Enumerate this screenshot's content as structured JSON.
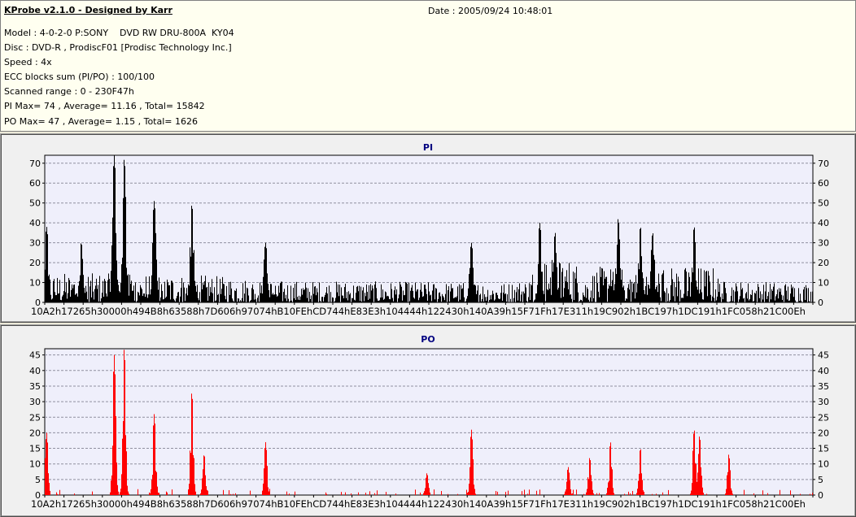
{
  "header": {
    "title": "KProbe v2.1.0 - Designed by Karr",
    "date": "Date : 2005/09/24 10:48:01",
    "lines": [
      "Model : 4-0-2-0 P:SONY    DVD RW DRU-800A  KY04",
      "Disc : DVD-R , ProdiscF01 [Prodisc Technology Inc.]",
      "Speed : 4x",
      "ECC blocks sum (PI/PO) : 100/100",
      "Scanned range : 0 - 230F47h",
      "PI Max= 74 , Average= 11.16 , Total= 15842",
      "PO Max= 47 , Average= 1.15 , Total= 1626"
    ]
  },
  "chart_data": [
    {
      "type": "bar",
      "title": "PI",
      "xlabel": "",
      "ylabel": "",
      "ylim": [
        0,
        74
      ],
      "yticks": [
        0,
        10,
        20,
        30,
        40,
        50,
        60,
        70
      ],
      "xtick_labels": [
        "10A2h",
        "17265h",
        "30000h",
        "494B8h",
        "63588h",
        "7D606h",
        "97074h",
        "B10FEh",
        "CD744h",
        "E83E3h",
        "104444h",
        "122430h",
        "140A39h",
        "15F71Fh",
        "17E311h",
        "19C902h",
        "1BC197h",
        "1DC191h",
        "1FC058h",
        "21C00Eh"
      ],
      "x_units": "percent of scanned range",
      "baseline": [
        [
          0,
          15
        ],
        [
          20,
          14
        ],
        [
          30,
          11
        ],
        [
          60,
          10
        ],
        [
          63,
          12
        ],
        [
          64,
          22
        ],
        [
          69,
          22
        ],
        [
          70,
          12
        ],
        [
          72,
          18
        ],
        [
          87,
          18
        ],
        [
          88,
          11
        ],
        [
          100,
          10
        ]
      ],
      "peaks": [
        [
          0.2,
          38
        ],
        [
          4.7,
          30
        ],
        [
          9.0,
          74
        ],
        [
          10.3,
          72
        ],
        [
          14.2,
          51
        ],
        [
          19.1,
          49
        ],
        [
          28.7,
          30
        ],
        [
          55.5,
          30
        ],
        [
          64.4,
          40
        ],
        [
          66.4,
          35
        ],
        [
          74.6,
          42
        ],
        [
          77.5,
          38
        ],
        [
          79.1,
          35
        ],
        [
          84.5,
          38
        ]
      ],
      "color": "#000000"
    },
    {
      "type": "bar",
      "title": "PO",
      "xlabel": "",
      "ylabel": "",
      "ylim": [
        0,
        47
      ],
      "yticks": [
        0,
        5,
        10,
        15,
        20,
        25,
        30,
        35,
        40,
        45
      ],
      "xtick_labels": [
        "10A2h",
        "17265h",
        "30000h",
        "494B8h",
        "63588h",
        "7D606h",
        "97074h",
        "B10FEh",
        "CD744h",
        "E83E3h",
        "104444h",
        "122430h",
        "140A39h",
        "15F71Fh",
        "17E311h",
        "19C902h",
        "1BC197h",
        "1DC191h",
        "1FC058h",
        "21C00Eh"
      ],
      "x_units": "percent of scanned range",
      "baseline": [
        [
          0,
          2
        ],
        [
          100,
          2
        ]
      ],
      "peaks": [
        [
          0.2,
          20
        ],
        [
          9.0,
          45
        ],
        [
          10.3,
          47
        ],
        [
          14.2,
          26
        ],
        [
          19.1,
          33
        ],
        [
          20.7,
          13
        ],
        [
          28.7,
          17
        ],
        [
          49.7,
          7
        ],
        [
          55.5,
          21
        ],
        [
          68.1,
          9
        ],
        [
          70.9,
          12
        ],
        [
          73.6,
          17
        ],
        [
          77.5,
          15
        ],
        [
          84.5,
          21
        ],
        [
          85.2,
          19
        ],
        [
          89.0,
          13
        ]
      ],
      "color": "#ff0000"
    }
  ]
}
